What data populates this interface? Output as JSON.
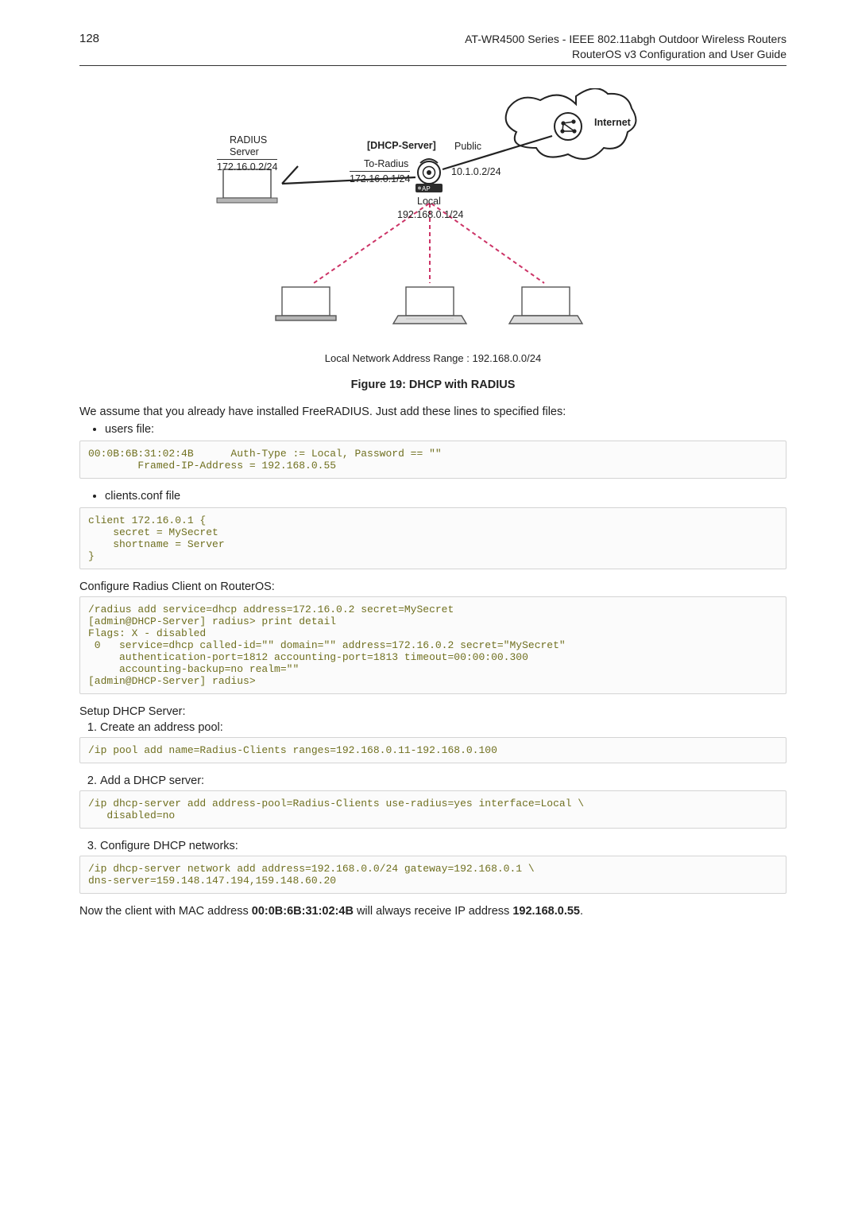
{
  "header": {
    "page_number": "128",
    "title_line1": "AT-WR4500 Series - IEEE 802.11abgh Outdoor Wireless Routers",
    "title_line2": "RouterOS v3 Configuration and User Guide"
  },
  "diagram": {
    "internet": "Internet",
    "radius_title": "RADIUS",
    "radius_sub": "Server",
    "radius_ip": "172.16.0.2/24",
    "dhcp_server": "[DHCP-Server]",
    "public": "Public",
    "to_radius": "To-Radius",
    "to_radius_ip": "172.16.0.1/24",
    "wan_ip": "10.1.0.2/24",
    "ap": "AP",
    "local": "Local",
    "lan_gw": "192.168.0.1/24",
    "caption": "Local Network Address Range : 192.168.0.0/24"
  },
  "figure_title": "Figure 19: DHCP with RADIUS",
  "intro": "We assume that you already have installed FreeRADIUS. Just add these lines to specified files:",
  "bullets": {
    "users": "users file:",
    "clients": "clients.conf file"
  },
  "code": {
    "users": "00:0B:6B:31:02:4B      Auth-Type := Local, Password == \"\"\n        Framed-IP-Address = 192.168.0.55",
    "clients": "client 172.16.0.1 {\n    secret = MySecret\n    shortname = Server\n}",
    "radius_conf": "/radius add service=dhcp address=172.16.0.2 secret=MySecret\n[admin@DHCP-Server] radius> print detail\nFlags: X - disabled\n 0   service=dhcp called-id=\"\" domain=\"\" address=172.16.0.2 secret=\"MySecret\"\n     authentication-port=1812 accounting-port=1813 timeout=00:00:00.300\n     accounting-backup=no realm=\"\"\n[admin@DHCP-Server] radius>",
    "pool": "/ip pool add name=Radius-Clients ranges=192.168.0.11-192.168.0.100",
    "dhcp_server": "/ip dhcp-server add address-pool=Radius-Clients use-radius=yes interface=Local \\\n   disabled=no",
    "dhcp_net": "/ip dhcp-server network add address=192.168.0.0/24 gateway=192.168.0.1 \\\ndns-server=159.148.147.194,159.148.60.20"
  },
  "sections": {
    "radius_client": "Configure Radius Client on RouterOS:",
    "setup_server": "Setup DHCP Server:"
  },
  "steps": {
    "s1": "Create an address pool:",
    "s2": "Add a DHCP server:",
    "s3": "Configure DHCP networks:"
  },
  "final": {
    "pre": "Now the client with MAC address ",
    "mac": "00:0B:6B:31:02:4B",
    "mid": " will always receive IP address ",
    "ip": "192.168.0.55",
    "post": "."
  }
}
